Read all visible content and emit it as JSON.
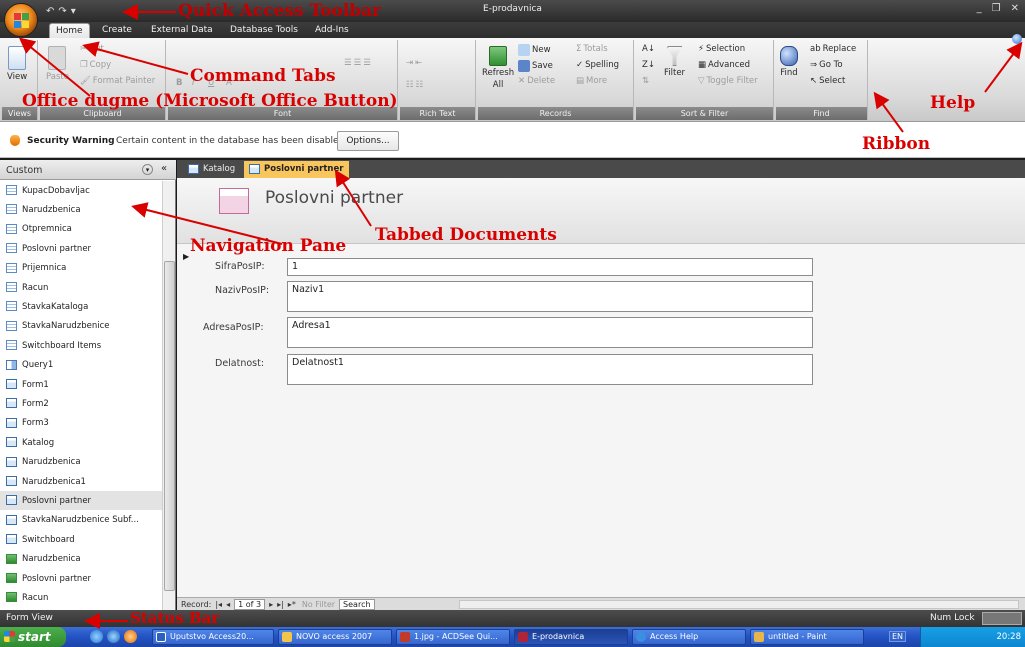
{
  "window": {
    "title": "E-prodavnica",
    "controls": [
      "_",
      "❐",
      "✕"
    ]
  },
  "quick_access": {
    "items": [
      "↶",
      "↷",
      "▾"
    ]
  },
  "tabs": [
    {
      "label": "Home",
      "active": true
    },
    {
      "label": "Create"
    },
    {
      "label": "External Data"
    },
    {
      "label": "Database Tools"
    },
    {
      "label": "Add-Ins"
    }
  ],
  "ribbon": {
    "groups": [
      {
        "label": "Views",
        "buttons": [
          "View"
        ]
      },
      {
        "label": "Clipboard",
        "buttons": [
          "Paste",
          "Cut",
          "Copy",
          "Format Painter"
        ]
      },
      {
        "label": "Font",
        "buttons": [
          "B",
          "I",
          "U",
          "A"
        ]
      },
      {
        "label": "Rich Text"
      },
      {
        "label": "Records",
        "buttons": [
          "Refresh All",
          "New",
          "Save",
          "Delete",
          "Totals",
          "Spelling",
          "More"
        ]
      },
      {
        "label": "Sort & Filter",
        "buttons": [
          "Filter",
          "Selection",
          "Advanced",
          "Toggle Filter"
        ]
      },
      {
        "label": "Find",
        "buttons": [
          "Find",
          "Replace",
          "Go To",
          "Select"
        ]
      }
    ],
    "refresh_label": "Refresh",
    "refresh_sub": "All",
    "new_label": "New",
    "save_label": "Save",
    "delete_label": "Delete",
    "totals_label": "Totals",
    "spelling_label": "Spelling",
    "more_label": "More",
    "filter_label": "Filter",
    "selection_label": "Selection",
    "advanced_label": "Advanced",
    "toggle_label": "Toggle Filter",
    "find_label": "Find",
    "replace_label": "Replace",
    "goto_label": "Go To",
    "select_label": "Select",
    "view_label": "View",
    "paste_label": "Paste",
    "cut_label": "Cut",
    "copy_label": "Copy",
    "format_label": "Format Painter"
  },
  "security": {
    "title": "Security Warning",
    "message": "Certain content in the database has been disabled",
    "options_button": "Options..."
  },
  "nav_pane": {
    "header": "Custom",
    "items": [
      {
        "label": "KupacDobavljac",
        "type": "table"
      },
      {
        "label": "Narudzbenica",
        "type": "table"
      },
      {
        "label": "Otpremnica",
        "type": "table"
      },
      {
        "label": "Poslovni partner",
        "type": "table"
      },
      {
        "label": "Prijemnica",
        "type": "table"
      },
      {
        "label": "Racun",
        "type": "table"
      },
      {
        "label": "StavkaKataloga",
        "type": "table"
      },
      {
        "label": "StavkaNarudzbenice",
        "type": "table"
      },
      {
        "label": "Switchboard Items",
        "type": "table"
      },
      {
        "label": "Query1",
        "type": "query"
      },
      {
        "label": "Form1",
        "type": "form"
      },
      {
        "label": "Form2",
        "type": "form"
      },
      {
        "label": "Form3",
        "type": "form"
      },
      {
        "label": "Katalog",
        "type": "form"
      },
      {
        "label": "Narudzbenica",
        "type": "form"
      },
      {
        "label": "Narudzbenica1",
        "type": "form"
      },
      {
        "label": "Poslovni partner",
        "type": "form",
        "selected": true
      },
      {
        "label": "StavkaNarudzbenice Subf...",
        "type": "form"
      },
      {
        "label": "Switchboard",
        "type": "form"
      },
      {
        "label": "Narudzbenica",
        "type": "report"
      },
      {
        "label": "Poslovni partner",
        "type": "report"
      },
      {
        "label": "Racun",
        "type": "report"
      }
    ]
  },
  "documents": {
    "tabs": [
      {
        "label": "Katalog"
      },
      {
        "label": "Poslovni partner",
        "active": true
      }
    ],
    "form_title": "Poslovni partner",
    "fields": [
      {
        "label": "SifraPosIP:",
        "value": "1"
      },
      {
        "label": "NazivPosIP:",
        "value": "Naziv1"
      },
      {
        "label": "AdresaPosIP:",
        "value": "Adresa1"
      },
      {
        "label": "Delatnost:",
        "value": "Delatnost1"
      }
    ],
    "record_nav": {
      "prefix": "Record:",
      "current": "1 of 3",
      "no_filter": "No Filter",
      "search": "Search"
    }
  },
  "status_bar": {
    "left": "Form View",
    "num_lock": "Num Lock"
  },
  "taskbar": {
    "start": "start",
    "tasks": [
      {
        "label": "Uputstvo Access20..."
      },
      {
        "label": "NOVO access 2007"
      },
      {
        "label": "1.jpg - ACDSee Qui..."
      },
      {
        "label": "E-prodavnica",
        "active": true
      },
      {
        "label": "Access Help"
      },
      {
        "label": "untitled - Paint"
      }
    ],
    "lang": "EN",
    "clock": "20:28"
  },
  "annotations": {
    "qat": "Quick Access Toolbar",
    "command_tabs": "Command Tabs",
    "office_button": "Office dugme (Microsoft Office Button)",
    "help": "Help",
    "ribbon": "Ribbon",
    "navigation_pane": "Navigation Pane",
    "tabbed_documents": "Tabbed Documents",
    "status_bar": "Status Bar"
  },
  "colors": {
    "annotation": "#d90000",
    "active_doc_tab": "#f9c55d",
    "ribbon_label": "#7a7a7a"
  }
}
